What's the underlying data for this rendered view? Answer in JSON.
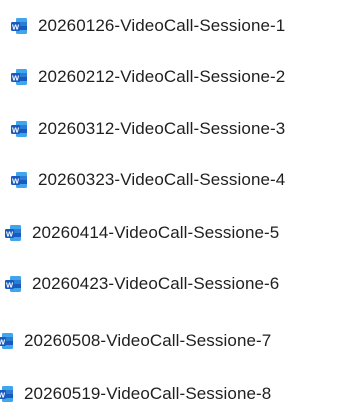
{
  "files": [
    {
      "name": "20260126-VideoCall-Sessione-1",
      "icon": "word-document-icon"
    },
    {
      "name": "20260212-VideoCall-Sessione-2",
      "icon": "word-document-icon"
    },
    {
      "name": "20260312-VideoCall-Sessione-3",
      "icon": "word-document-icon"
    },
    {
      "name": "20260323-VideoCall-Sessione-4",
      "icon": "word-document-icon"
    },
    {
      "name": "20260414-VideoCall-Sessione-5",
      "icon": "word-document-icon"
    },
    {
      "name": "20260423-VideoCall-Sessione-6",
      "icon": "word-document-icon"
    },
    {
      "name": "20260508-VideoCall-Sessione-7",
      "icon": "word-document-icon"
    },
    {
      "name": "20260519-VideoCall-Sessione-8",
      "icon": "word-document-icon"
    }
  ],
  "colors": {
    "word_blue": "#185abd",
    "word_light_blue": "#41a5ee",
    "text": "#1f1f1f"
  }
}
